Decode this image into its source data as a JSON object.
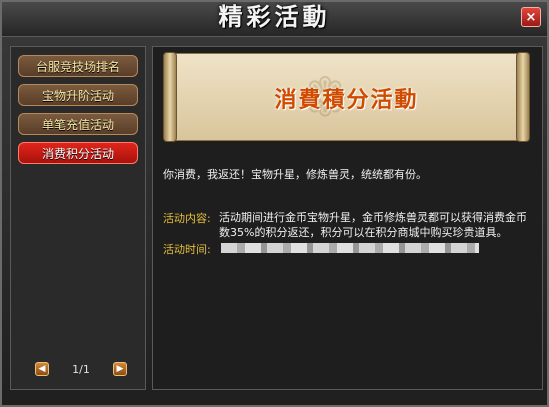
{
  "window": {
    "title": "精彩活動",
    "close_label": "×"
  },
  "sidebar": {
    "items": [
      {
        "label": "台服竞技场排名"
      },
      {
        "label": "宝物升阶活动"
      },
      {
        "label": "单笔充值活动"
      },
      {
        "label": "消费积分活动"
      }
    ],
    "active_index": 3
  },
  "pager": {
    "prev_icon": "◀",
    "next_icon": "▶",
    "page_text": "1/1"
  },
  "main": {
    "banner_title": "消費積分活動",
    "intro": "你消费，我返还！宝物升星，修炼兽灵，统统都有份。",
    "content_label": "活动内容:",
    "content_text": "活动期间进行金币宝物升星，金币修炼兽灵都可以获得消费金币数35%的积分返还，积分可以在积分商城中购买珍贵道具。",
    "time_label": "活动时间:"
  }
}
